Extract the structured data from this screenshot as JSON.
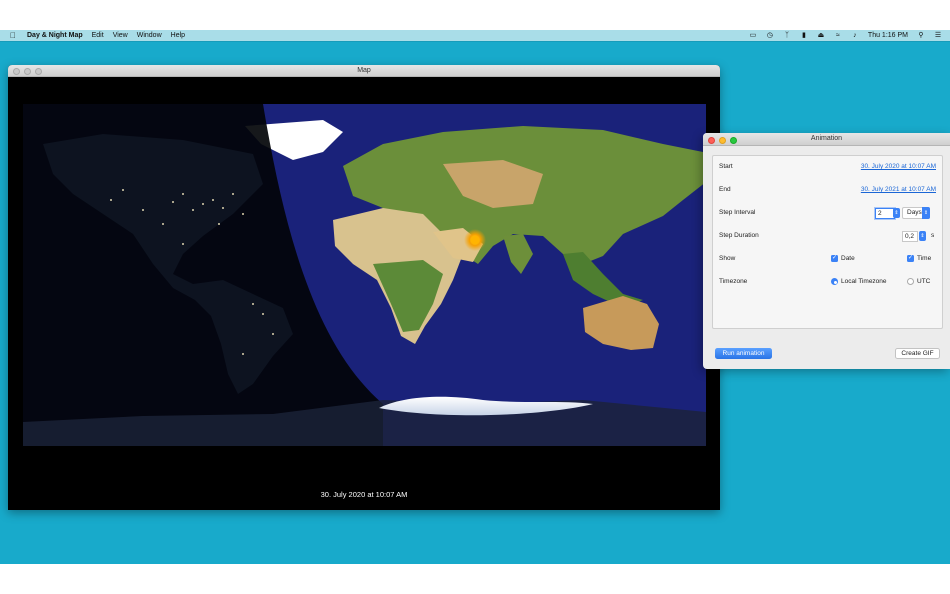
{
  "menubar": {
    "app_name": "Day & Night Map",
    "menus": [
      "Edit",
      "View",
      "Window",
      "Help"
    ],
    "clock": "Thu 1:16 PM",
    "status_icons": [
      "airplay-icon",
      "time-machine-icon",
      "bluetooth-icon",
      "battery-icon",
      "eject-icon",
      "wifi-icon",
      "volume-icon",
      "spotlight-search-icon",
      "control-center-icon"
    ]
  },
  "map_window": {
    "title": "Map",
    "caption": "30. July 2020 at 10:07 AM"
  },
  "animation": {
    "title": "Animation",
    "start_label": "Start",
    "start_value": "30. July 2020 at 10:07 AM",
    "end_label": "End",
    "end_value": "30. July 2021 at 10:07 AM",
    "step_interval_label": "Step Interval",
    "step_interval_value": "2",
    "step_interval_unit": "Days",
    "step_duration_label": "Step Duration",
    "step_duration_value": "0,2",
    "step_duration_unit": "s",
    "show_label": "Show",
    "show_date": "Date",
    "show_time": "Time",
    "timezone_label": "Timezone",
    "tz_local": "Local Timezone",
    "tz_utc": "UTC",
    "run_button": "Run animation",
    "gif_button": "Create GIF"
  },
  "colors": {
    "desktop": "#18aacb",
    "accent": "#3b82f6",
    "link": "#1a66d6"
  }
}
